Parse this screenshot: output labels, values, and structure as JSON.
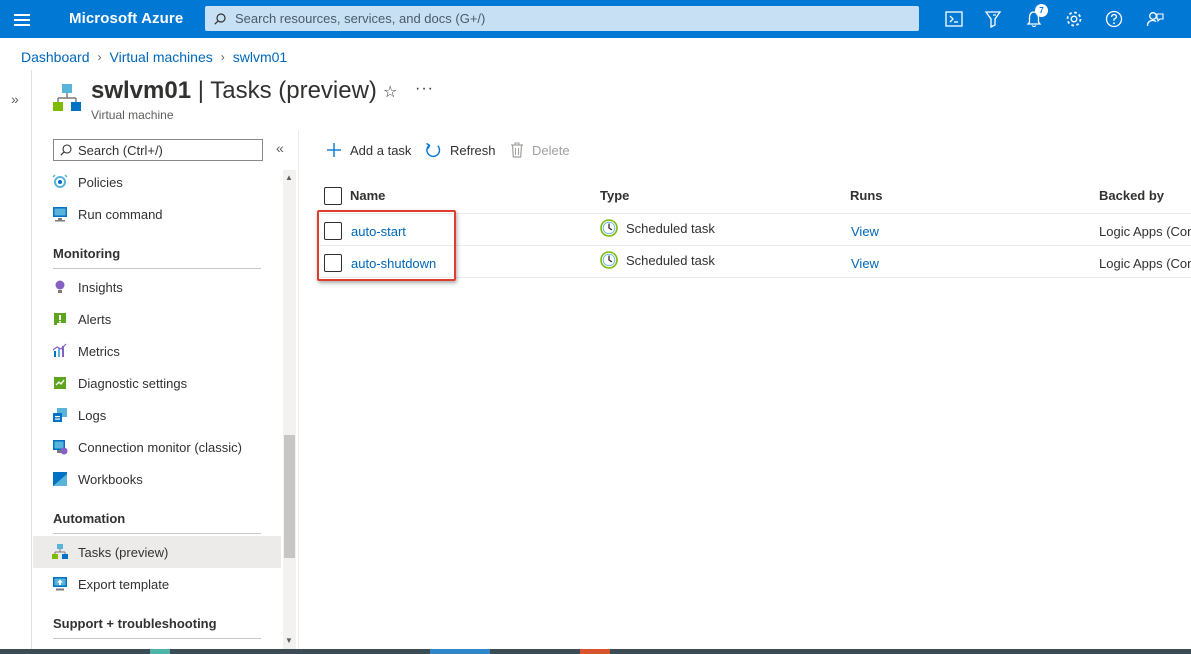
{
  "topbar": {
    "brand": "Microsoft Azure",
    "search_placeholder": "Search resources, services, and docs (G+/)",
    "notification_count": "7",
    "icons": [
      "cloud-shell-icon",
      "directory-filter-icon",
      "notifications-icon",
      "settings-icon",
      "help-icon",
      "feedback-icon"
    ]
  },
  "breadcrumb": [
    "Dashboard",
    "Virtual machines",
    "swlvm01"
  ],
  "header": {
    "resource_name": "swlvm01",
    "page_title": " | Tasks (preview)",
    "subtitle": "Virtual machine"
  },
  "sidebar": {
    "search_placeholder": "Search (Ctrl+/)",
    "top_items": [
      {
        "label": "Policies",
        "icon": "policies-icon"
      },
      {
        "label": "Run command",
        "icon": "run-command-icon"
      }
    ],
    "sections": [
      {
        "title": "Monitoring",
        "items": [
          {
            "label": "Insights",
            "icon": "insights-icon"
          },
          {
            "label": "Alerts",
            "icon": "alerts-icon"
          },
          {
            "label": "Metrics",
            "icon": "metrics-icon"
          },
          {
            "label": "Diagnostic settings",
            "icon": "diagnostic-settings-icon"
          },
          {
            "label": "Logs",
            "icon": "logs-icon"
          },
          {
            "label": "Connection monitor (classic)",
            "icon": "connection-monitor-icon"
          },
          {
            "label": "Workbooks",
            "icon": "workbooks-icon"
          }
        ]
      },
      {
        "title": "Automation",
        "items": [
          {
            "label": "Tasks (preview)",
            "icon": "tasks-icon",
            "selected": true
          },
          {
            "label": "Export template",
            "icon": "export-template-icon"
          }
        ]
      },
      {
        "title": "Support + troubleshooting",
        "items": []
      }
    ]
  },
  "toolbar": {
    "add_label": "Add a task",
    "refresh_label": "Refresh",
    "delete_label": "Delete"
  },
  "table": {
    "columns": [
      "Name",
      "Type",
      "Runs",
      "Backed by"
    ],
    "rows": [
      {
        "name": "auto-start",
        "type": "Scheduled task",
        "runs": "View",
        "backed_by": "Logic Apps (Con"
      },
      {
        "name": "auto-shutdown",
        "type": "Scheduled task",
        "runs": "View",
        "backed_by": "Logic Apps (Con"
      }
    ]
  },
  "colors": {
    "azure_blue": "#0078d4",
    "link_blue": "#0067b8",
    "highlight_red": "#e03e2d",
    "selected_bg": "#edebe9"
  }
}
